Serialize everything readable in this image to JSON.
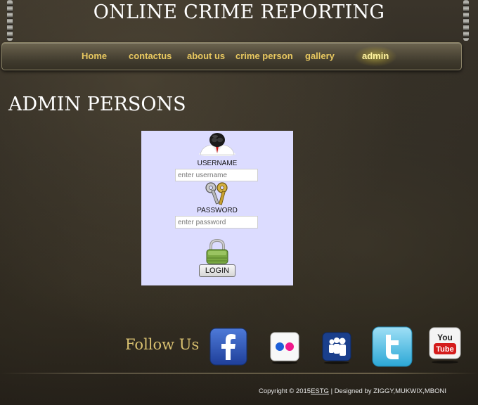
{
  "header": {
    "title": "ONLINE CRIME REPORTING"
  },
  "nav": {
    "items": [
      {
        "label": "Home"
      },
      {
        "label": "contactus"
      },
      {
        "label": "about us"
      },
      {
        "label": "crime person"
      },
      {
        "label": "gallery"
      },
      {
        "label": "admin"
      }
    ],
    "active": "admin"
  },
  "main": {
    "heading": "ADMIN PERSONS"
  },
  "login": {
    "username_label": "USERNAME",
    "username_placeholder": "enter username",
    "password_label": "PASSWORD",
    "password_placeholder": "enter password",
    "button_label": "LOGIN",
    "user_icon": "user-avatar-icon",
    "keys_icon": "keys-icon",
    "lock_icon": "padlock-icon"
  },
  "social": {
    "label": "Follow Us",
    "icons": [
      "facebook-icon",
      "flickr-icon",
      "myspace-icon",
      "twitter-icon",
      "youtube-icon"
    ]
  },
  "footer": {
    "copyright_prefix": "Copyright © 2015",
    "link_text": "ESTG",
    "credits": " | Designed by ZIGGY,MUKWIX,MBONI"
  },
  "colors": {
    "nav_text": "#e8c860",
    "follow_text": "#d8c070",
    "login_bg": "#dcdcff"
  }
}
